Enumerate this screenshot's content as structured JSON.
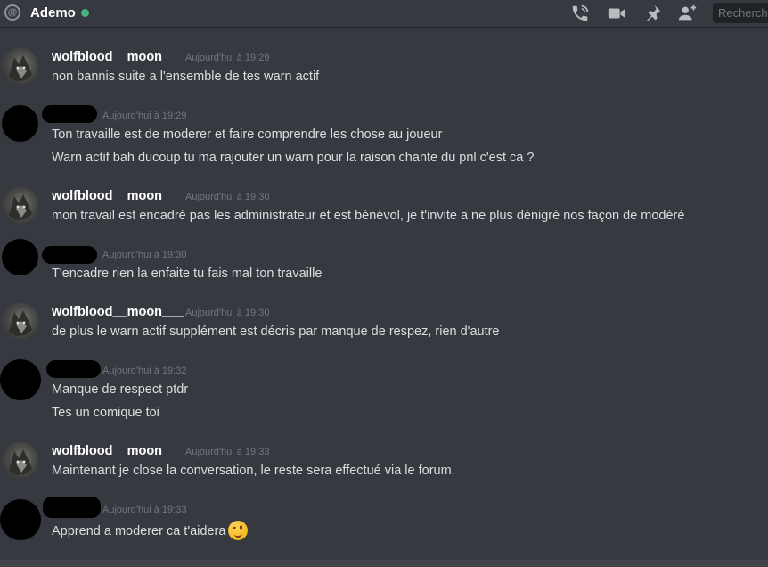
{
  "header": {
    "channel_name": "Ademo",
    "status": "online",
    "search_placeholder": "Rechercher",
    "icons": [
      "at-icon",
      "phone-call-icon",
      "video-call-icon",
      "pin-icon",
      "add-friend-icon"
    ]
  },
  "colors": {
    "background": "#36393f",
    "status_online": "#43b581",
    "new_messages_divider": "#f04747",
    "timestamp": "#72767d",
    "text": "#dcddde"
  },
  "messages": [
    {
      "author": "wolfblood__moon___",
      "timestamp": "Aujourd'hui à 19:29",
      "lines": [
        "non bannis suite a l'ensemble de tes warn actif"
      ]
    },
    {
      "author": "",
      "timestamp": "Aujourd'hui à 19:29",
      "lines": [
        "Ton travaille est de moderer et faire comprendre les chose au joueur",
        "Warn actif bah ducoup tu ma rajouter un warn pour la raison chante du pnl c'est ca ?"
      ]
    },
    {
      "author": "wolfblood__moon___",
      "timestamp": "Aujourd'hui à 19:30",
      "lines": [
        "mon travail est encadré pas les administrateur et est bénévol, je t'invite a ne plus dénigré nos façon de modéré"
      ]
    },
    {
      "author": "",
      "timestamp": "Aujourd'hui à 19:30",
      "lines": [
        "T'encadre rien la enfaite tu fais mal ton travaille"
      ]
    },
    {
      "author": "wolfblood__moon___",
      "timestamp": "Aujourd'hui à 19:30",
      "lines": [
        "de plus le warn actif supplément est décris par manque de respez, rien d'autre"
      ]
    },
    {
      "author": "",
      "timestamp": "Aujourd'hui à 19:32",
      "lines": [
        "Manque de respect ptdr",
        "Tes un comique toi"
      ]
    },
    {
      "author": "wolfblood__moon___",
      "timestamp": "Aujourd'hui à 19:33",
      "lines": [
        "Maintenant je close la conversation, le reste sera effectué via le forum."
      ]
    },
    {
      "author": "",
      "timestamp": "Aujourd'hui à 19:33",
      "lines": [
        "Apprend a moderer ca t'aidera"
      ],
      "emoji": "winking-face-emoji"
    }
  ]
}
